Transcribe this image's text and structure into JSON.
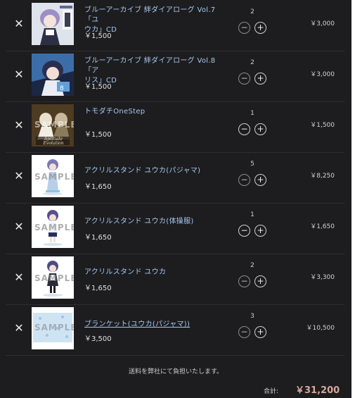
{
  "colors": {
    "background": "#1d1d1f",
    "product_link": "#a7c7ef",
    "total_accent": "#d9a79b"
  },
  "icons": {
    "remove": "close-icon",
    "minus": "minus-circle-icon",
    "plus": "plus-circle-icon"
  },
  "cart": {
    "items": [
      {
        "name_line1": "ブルーアーカイブ 絆ダイアローグ Vol.7「ユ",
        "name_line2": "ウカ」CD",
        "price": "￥1,500",
        "quantity": "2",
        "subtotal": "￥3,000",
        "remove_icon": "✕",
        "minus": "−",
        "plus": "+"
      },
      {
        "name_line1": "ブルーアーカイブ 絆ダイアローグ Vol.8「ア",
        "name_line2": "リス」CD",
        "price": "￥1,500",
        "quantity": "2",
        "subtotal": "￥3,000",
        "remove_icon": "✕",
        "minus": "−",
        "plus": "+"
      },
      {
        "name_line1": "トモダチOneStep",
        "name_line2": "",
        "price": "￥1,500",
        "quantity": "1",
        "subtotal": "￥1,500",
        "remove_icon": "✕",
        "minus": "−",
        "plus": "+"
      },
      {
        "name_line1": "アクリルスタンド ユウカ(パジャマ)",
        "name_line2": "",
        "price": "￥1,650",
        "quantity": "5",
        "subtotal": "￥8,250",
        "remove_icon": "✕",
        "minus": "−",
        "plus": "+"
      },
      {
        "name_line1": "アクリルスタンド ユウカ(体操服)",
        "name_line2": "",
        "price": "￥1,650",
        "quantity": "1",
        "subtotal": "￥1,650",
        "remove_icon": "✕",
        "minus": "−",
        "plus": "+"
      },
      {
        "name_line1": "アクリルスタンド ユウカ",
        "name_line2": "",
        "price": "￥1,650",
        "quantity": "2",
        "subtotal": "￥3,300",
        "remove_icon": "✕",
        "minus": "−",
        "plus": "+"
      },
      {
        "name_line1": "ブランケット(ユウカ(パジャマ))",
        "name_line2": "",
        "price": "￥3,500",
        "quantity": "3",
        "subtotal": "￥10,500",
        "remove_icon": "✕",
        "minus": "−",
        "plus": "+"
      }
    ],
    "shipping_note": "送料を弊社にて負担いたします。",
    "total_label": "合計:",
    "total_value": "￥31,200",
    "sample_watermark": "SAMPLE",
    "cover_text": "Aptitude Evolution"
  }
}
